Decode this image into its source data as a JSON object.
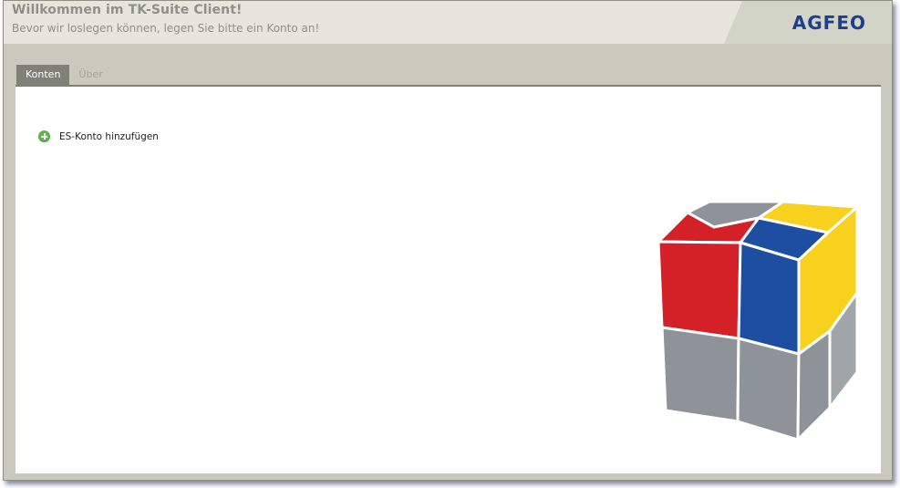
{
  "header": {
    "title": "Willkommen im TK-Suite Client!",
    "subtitle": "Bevor wir loslegen können, legen Sie bitte ein Konto an!",
    "logo": "AGFEO"
  },
  "tabs": [
    {
      "label": "Konten",
      "active": true
    },
    {
      "label": "Über",
      "active": false
    }
  ],
  "main": {
    "add_account_label": "ES-Konto hinzufügen",
    "add_icon": "plus-circle-icon"
  },
  "colors": {
    "cube_red": "#d42027",
    "cube_blue": "#1e4ea1",
    "cube_yellow": "#f7d11e",
    "cube_gray": "#8e9399",
    "add_icon_green": "#5fb548",
    "logo_blue": "#1e3e8e"
  }
}
